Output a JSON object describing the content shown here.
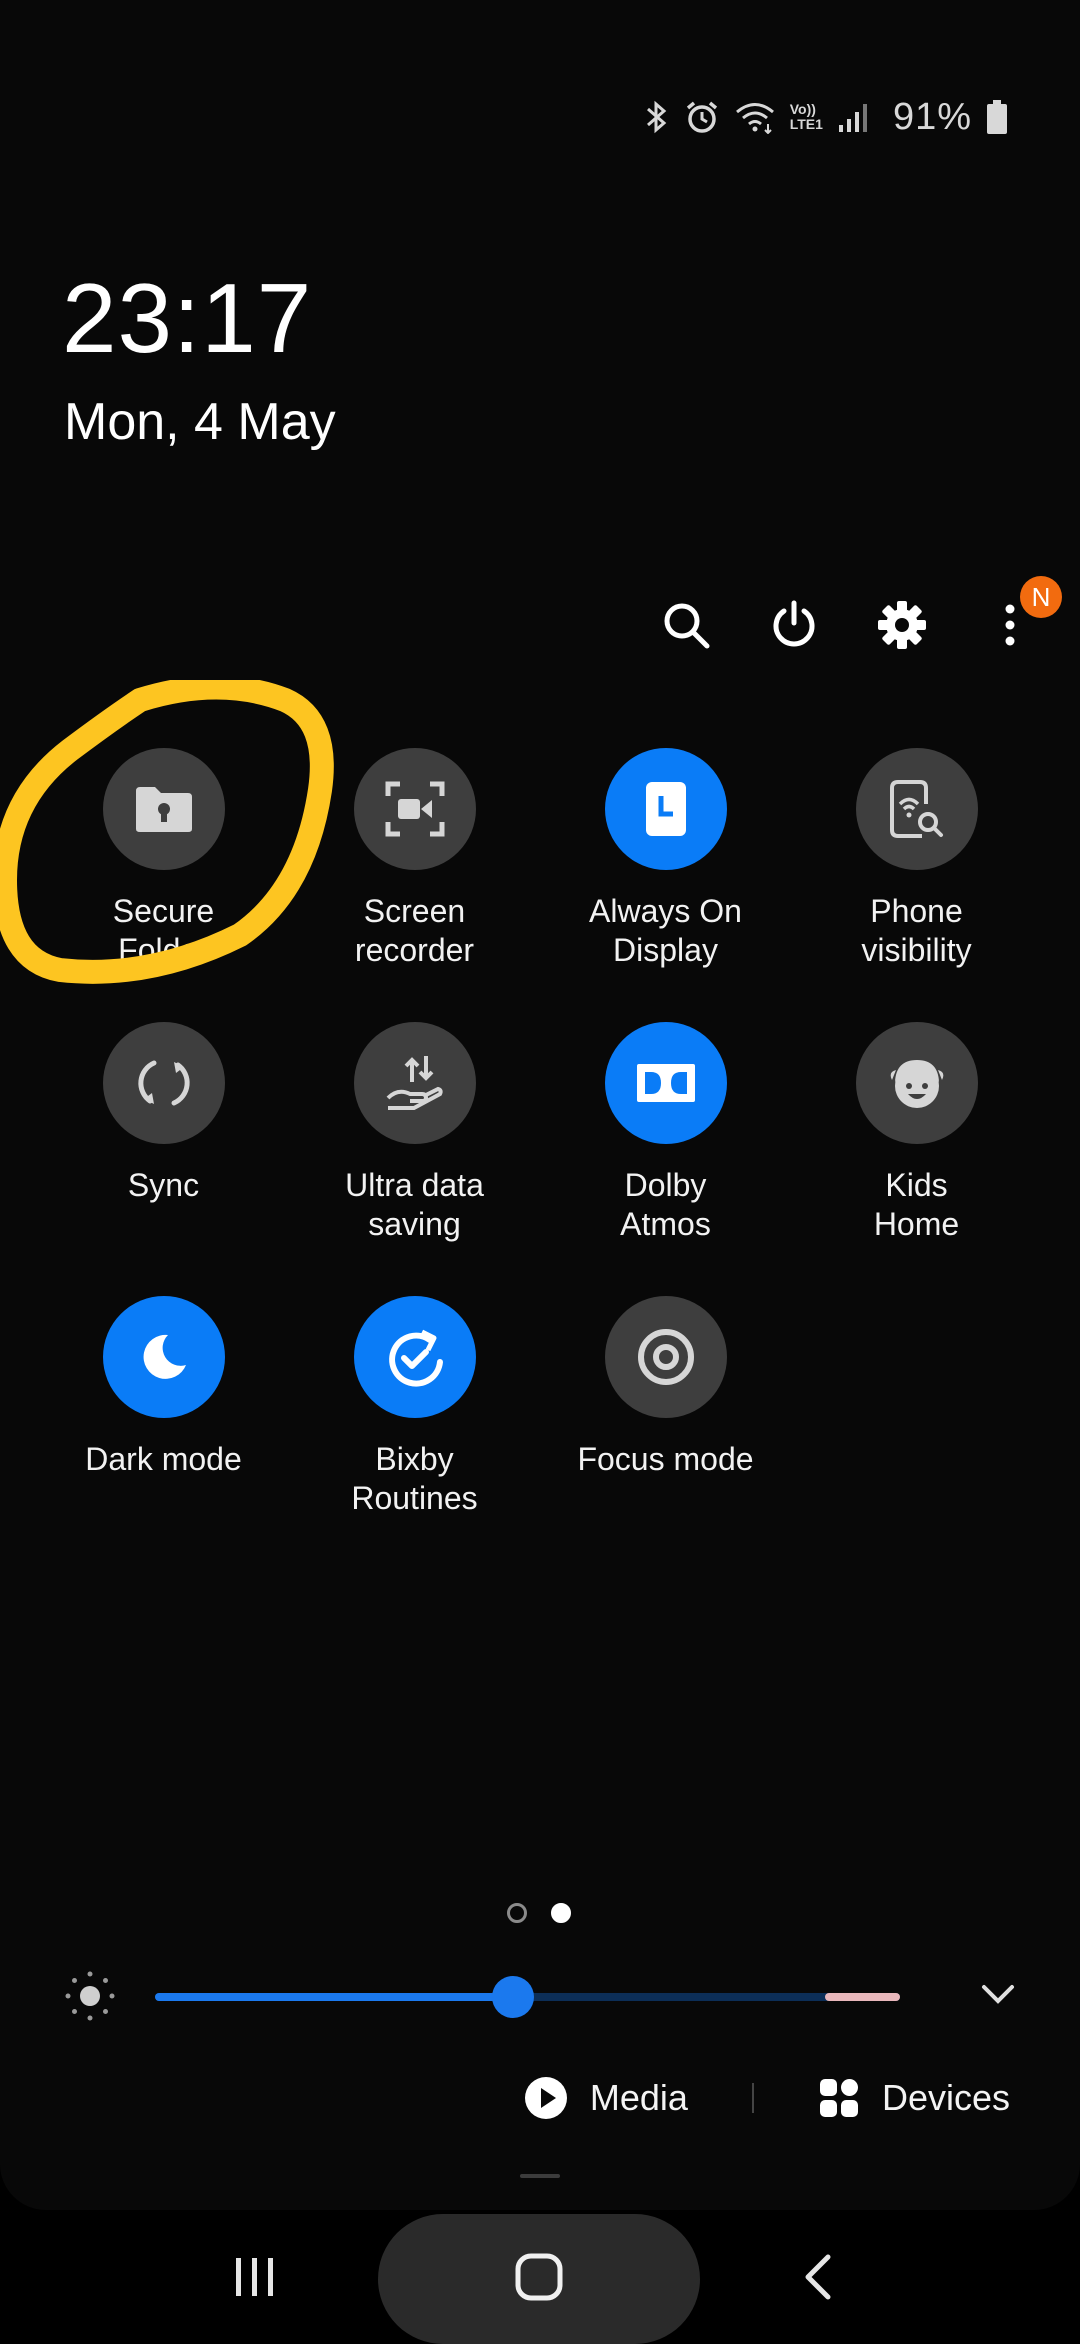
{
  "status_bar": {
    "battery_percent": "91%",
    "icons": [
      "bluetooth-icon",
      "alarm-icon",
      "wifi-icon",
      "volte-icon",
      "signal-icon",
      "battery-icon"
    ],
    "volte_label_top": "Vo))",
    "volte_label_bottom": "LTE1"
  },
  "clock": {
    "time": "23:17",
    "date": "Mon, 4 May"
  },
  "toolbar": {
    "icons": [
      "search-icon",
      "power-icon",
      "settings-gear-icon",
      "more-options-icon"
    ],
    "notification_badge": "N"
  },
  "tiles": [
    {
      "label": "Secure\nFolder",
      "icon": "secure-folder-icon",
      "active": false
    },
    {
      "label": "Screen\nrecorder",
      "icon": "screen-recorder-icon",
      "active": false
    },
    {
      "label": "Always On\nDisplay",
      "icon": "always-on-display-icon",
      "active": true
    },
    {
      "label": "Phone\nvisibility",
      "icon": "phone-visibility-icon",
      "active": false
    },
    {
      "label": "Sync",
      "icon": "sync-icon",
      "active": false
    },
    {
      "label": "Ultra data\nsaving",
      "icon": "ultra-data-saving-icon",
      "active": false
    },
    {
      "label": "Dolby\nAtmos",
      "icon": "dolby-atmos-icon",
      "active": true
    },
    {
      "label": "Kids\nHome",
      "icon": "kids-home-icon",
      "active": false
    },
    {
      "label": "Dark mode",
      "icon": "dark-mode-moon-icon",
      "active": true
    },
    {
      "label": "Bixby\nRoutines",
      "icon": "bixby-routines-icon",
      "active": true
    },
    {
      "label": "Focus mode",
      "icon": "focus-mode-icon",
      "active": false
    }
  ],
  "pager": {
    "pages": 2,
    "current": 2
  },
  "brightness": {
    "level": 0.48
  },
  "media_devices": {
    "media_label": "Media",
    "devices_label": "Devices"
  },
  "colors": {
    "active_tile": "#0a7cf7",
    "inactive_tile": "#3e3e3e",
    "annotation": "#fdc521",
    "badge": "#f26b0f"
  }
}
